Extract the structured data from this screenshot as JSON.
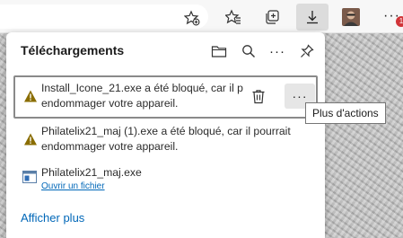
{
  "toolbar": {
    "icons": [
      "star-add-icon",
      "favorites-icon",
      "collections-icon",
      "downloads-icon",
      "profile-avatar",
      "more-icon"
    ],
    "more_glyph": "···",
    "notification_count": "1"
  },
  "downloads_panel": {
    "title": "Téléchargements",
    "header_icons": [
      "folder-icon",
      "search-icon",
      "more-options-icon",
      "pin-icon"
    ],
    "header_more_glyph": "···",
    "items": [
      {
        "line1": "Install_Icone_21.exe a été bloqué, car il p",
        "line2": "endommager votre appareil.",
        "status": "blocked"
      },
      {
        "line1": "Philatelix21_maj (1).exe a été bloqué, car il pourrait",
        "line2": "endommager votre appareil.",
        "status": "blocked"
      },
      {
        "name": "Philatelix21_maj.exe",
        "action": "Ouvrir un fichier",
        "status": "completed"
      }
    ],
    "item_more_glyph": "···",
    "show_more": "Afficher plus"
  },
  "tooltip": "Plus d'actions",
  "colors": {
    "accent": "#0067b8",
    "warning": "#8a6d00",
    "badge": "#d13438"
  }
}
